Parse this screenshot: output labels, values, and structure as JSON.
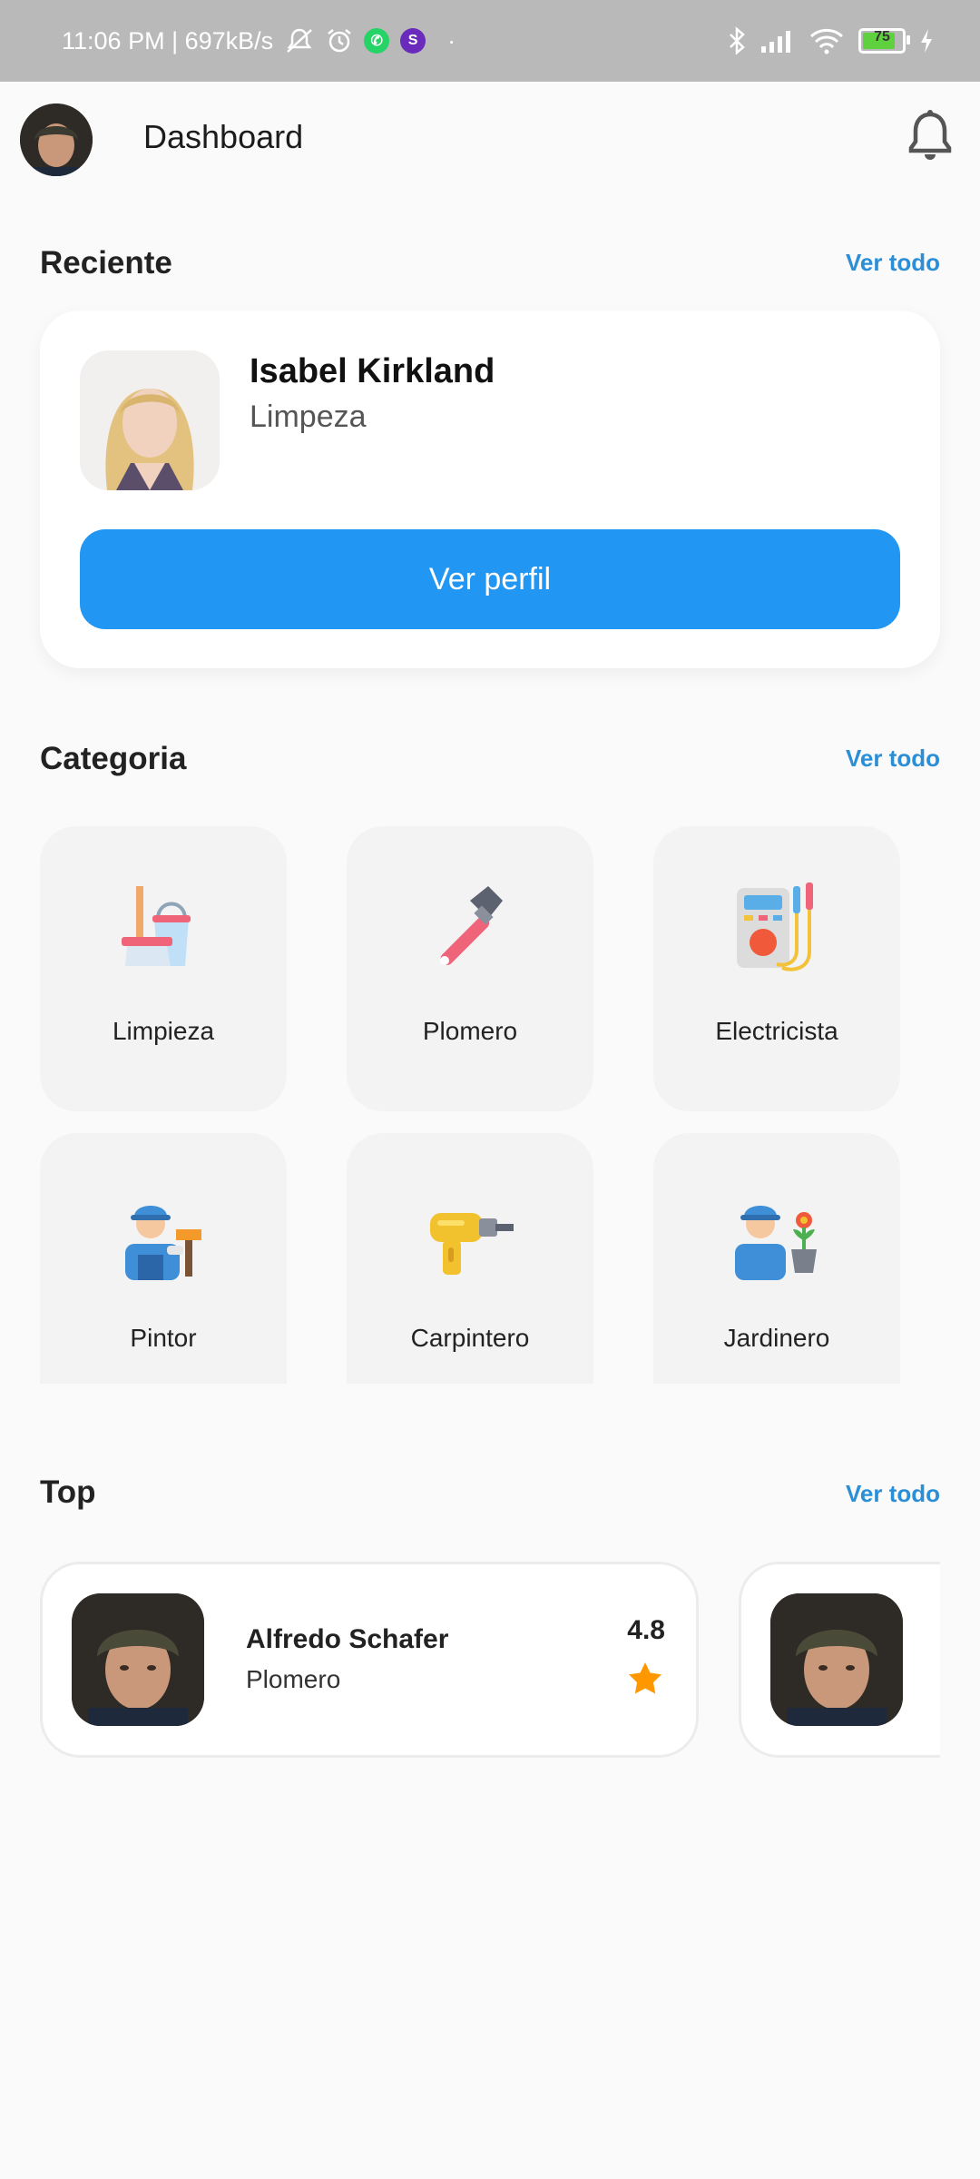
{
  "status_bar": {
    "time_speed": "11:06 PM | 697kB/s",
    "battery_level": "75",
    "colors": {
      "background": "#b9b9b9",
      "whatsapp": "#25d366",
      "app2": "#6a2bbd"
    },
    "icons": [
      "muted-bell-icon",
      "alarm-icon",
      "whatsapp-icon",
      "app-icon",
      "bluetooth-icon",
      "signal-icon",
      "wifi-icon",
      "battery-icon",
      "charging-icon"
    ]
  },
  "header": {
    "title": "Dashboard",
    "icons": [
      "avatar",
      "notification-bell-icon"
    ]
  },
  "recent": {
    "title": "Reciente",
    "see_all": "Ver todo",
    "person": {
      "name": "Isabel Kirkland",
      "role": "Limpeza"
    },
    "button": "Ver perfil"
  },
  "categories": {
    "title": "Categoria",
    "see_all": "Ver todo",
    "items": [
      {
        "label": "Limpieza",
        "icon": "cleaning-broom-bucket-icon"
      },
      {
        "label": "Plomero",
        "icon": "pipe-wrench-icon"
      },
      {
        "label": "Electricista",
        "icon": "multimeter-icon"
      },
      {
        "label": "Pintor",
        "icon": "painter-worker-icon"
      },
      {
        "label": "Carpintero",
        "icon": "power-drill-icon"
      },
      {
        "label": "Jardinero",
        "icon": "gardener-icon"
      }
    ]
  },
  "top": {
    "title": "Top",
    "see_all": "Ver todo",
    "items": [
      {
        "name": "Alfredo Schafer",
        "role": "Plomero",
        "rating": "4.8"
      }
    ]
  },
  "colors": {
    "accent": "#2196f3",
    "link": "#2c8fd6",
    "star": "#ff9800"
  }
}
